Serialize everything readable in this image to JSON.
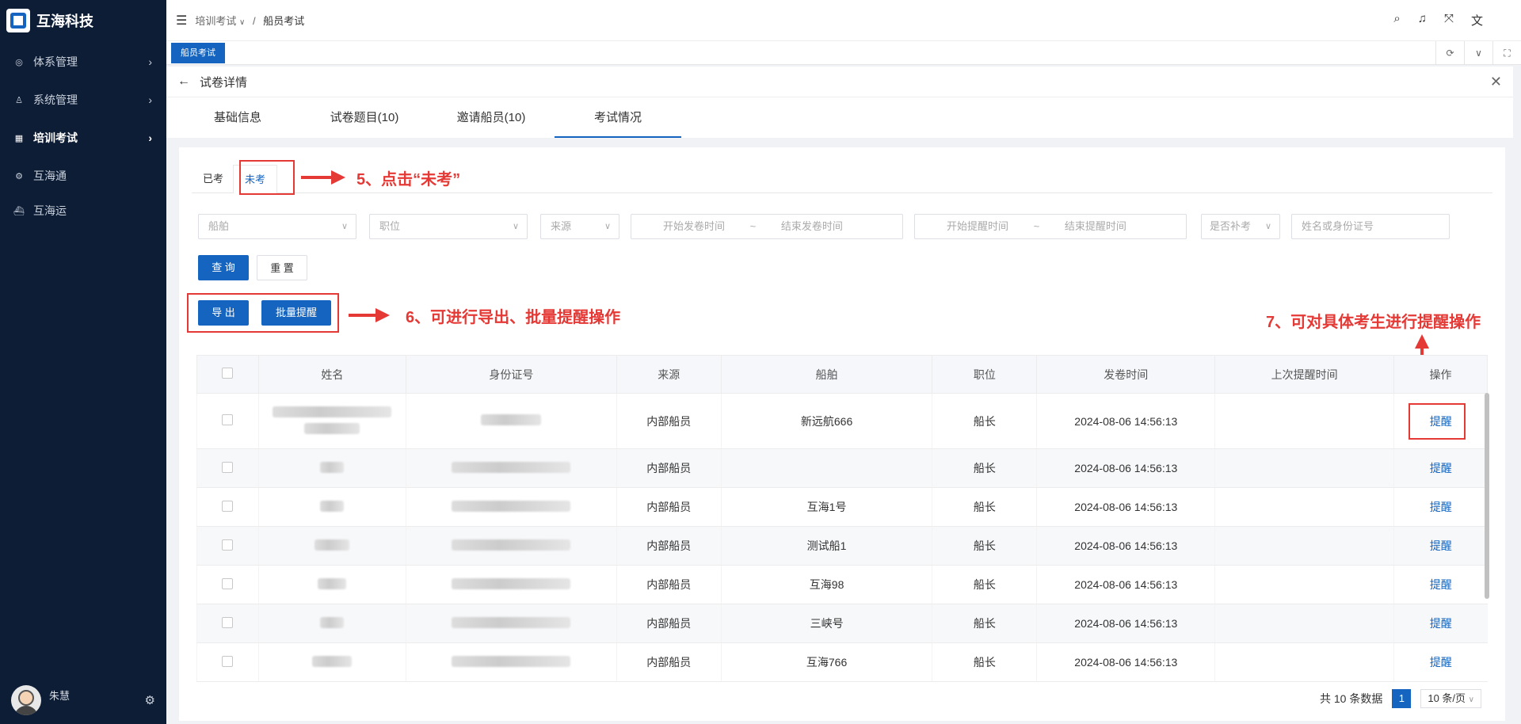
{
  "brand": {
    "name": "互海科技"
  },
  "sidebar": {
    "items": [
      {
        "label": "体系管理",
        "icon": "sms-icon"
      },
      {
        "label": "系统管理",
        "icon": "user-settings-icon"
      },
      {
        "label": "培训考试",
        "icon": "grid-icon"
      },
      {
        "label": "互海通",
        "icon": "gear-icon"
      },
      {
        "label": "互海运",
        "icon": "ship-icon"
      }
    ],
    "user": "朱慧"
  },
  "topbar": {
    "breadcrumb1": "培训考试",
    "sep": "/",
    "breadcrumb2": "船员考试"
  },
  "tagsbar": {
    "tag": "船员考试"
  },
  "page": {
    "title": "试卷详情"
  },
  "tabs": [
    "基础信息",
    "试卷题目(10)",
    "邀请船员(10)",
    "考试情况"
  ],
  "subtabs": [
    "已考",
    "未考"
  ],
  "filters": {
    "ship": "船舶",
    "position": "职位",
    "source": "来源",
    "send_start": "开始发卷时间",
    "tilde": "~",
    "send_end": "结束发卷时间",
    "remind_start": "开始提醒时间",
    "remind_end": "结束提醒时间",
    "makeup": "是否补考",
    "name_id": "姓名或身份证号"
  },
  "buttons": {
    "query": "查 询",
    "reset": "重 置",
    "export": "导 出",
    "batch": "批量提醒"
  },
  "annotations": {
    "a5": "5、点击“未考”",
    "a6": "6、可进行导出、批量提醒操作",
    "a7": "7、可对具体考生进行提醒操作"
  },
  "table": {
    "headers": [
      "姓名",
      "身份证号",
      "来源",
      "船舶",
      "职位",
      "发卷时间",
      "上次提醒时间",
      "操作"
    ],
    "rows": [
      {
        "source": "内部船员",
        "ship": "新远航666",
        "position": "船长",
        "time": "2024-08-06 14:56:13",
        "last": "",
        "action": "提醒"
      },
      {
        "source": "内部船员",
        "ship": "",
        "position": "船长",
        "time": "2024-08-06 14:56:13",
        "last": "",
        "action": "提醒"
      },
      {
        "source": "内部船员",
        "ship": "互海1号",
        "position": "船长",
        "time": "2024-08-06 14:56:13",
        "last": "",
        "action": "提醒"
      },
      {
        "source": "内部船员",
        "ship": "测试船1",
        "position": "船长",
        "time": "2024-08-06 14:56:13",
        "last": "",
        "action": "提醒"
      },
      {
        "source": "内部船员",
        "ship": "互海98",
        "position": "船长",
        "time": "2024-08-06 14:56:13",
        "last": "",
        "action": "提醒"
      },
      {
        "source": "内部船员",
        "ship": "三峡号",
        "position": "船长",
        "time": "2024-08-06 14:56:13",
        "last": "",
        "action": "提醒"
      },
      {
        "source": "内部船员",
        "ship": "互海766",
        "position": "船长",
        "time": "2024-08-06 14:56:13",
        "last": "",
        "action": "提醒"
      }
    ]
  },
  "pager": {
    "total": "共 10 条数据",
    "page": "1",
    "size": "10 条/页"
  },
  "colors": {
    "sidebar": "#0e1d36",
    "primary": "#1565c0",
    "annotation": "#e53935"
  }
}
